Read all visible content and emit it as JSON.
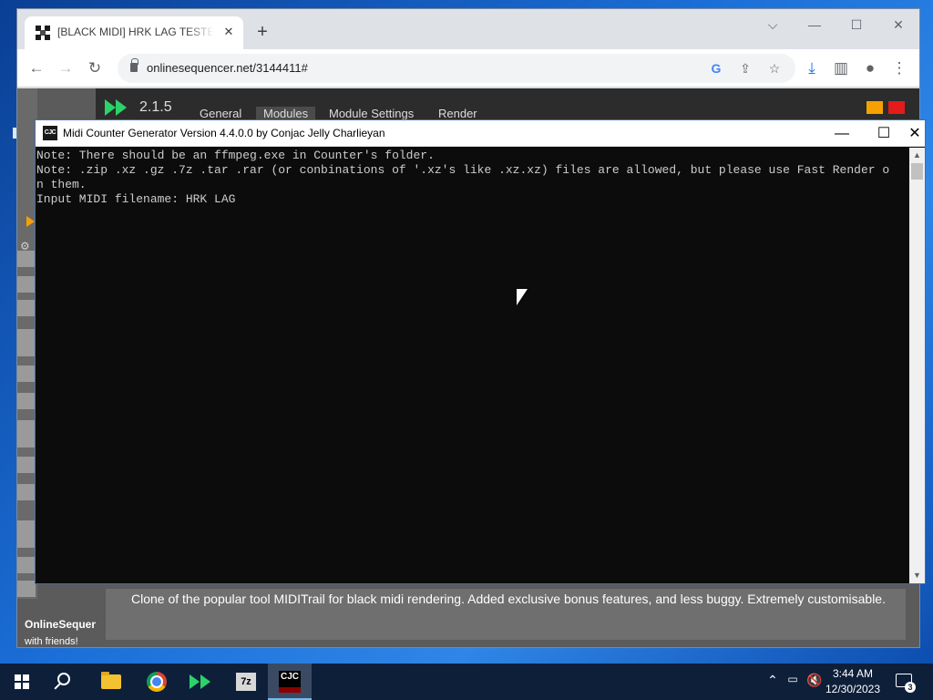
{
  "browser": {
    "tab_title": "[BLACK MIDI] HRK LAG TESTER",
    "tab_close": "✕",
    "new_tab": "+",
    "url": "onlinesequencer.net/3144411#",
    "window_controls": {
      "chevron": "⌵",
      "minimize": "—",
      "maximize": "☐",
      "close": "✕"
    }
  },
  "page": {
    "version": "2.1.5",
    "nav": [
      "General",
      "Modules",
      "Module Settings",
      "Render"
    ],
    "module_description": "Clone of the popular tool MIDITrail for black midi rendering. Added exclusive bonus features, and less buggy. Extremely customisable.",
    "site_name": "OnlineSequencer",
    "site_tagline": "with friends!"
  },
  "console": {
    "icon_text": "CJC",
    "title": "Midi Counter Generator Version 4.4.0.0 by Conjac Jelly Charlieyan",
    "controls": {
      "minimize": "—",
      "maximize": "☐",
      "close": "✕"
    },
    "lines": [
      "Note: There should be an ffmpeg.exe in Counter's folder.",
      "Note: .zip .xz .gz .7z .tar .rar (or conbinations of '.xz's like .xz.xz) files are allowed, but please use Fast Render o",
      "n them.",
      "Input MIDI filename: HRK LAG"
    ]
  },
  "taskbar": {
    "apps": [
      "start",
      "search",
      "file-explorer",
      "chrome",
      "online-sequencer",
      "7-zip",
      "midi-counter-generator"
    ],
    "sevenzip_label": "7z",
    "cjc_label": "CJC",
    "time": "3:44 AM",
    "date": "12/30/2023",
    "notification_count": "3"
  }
}
